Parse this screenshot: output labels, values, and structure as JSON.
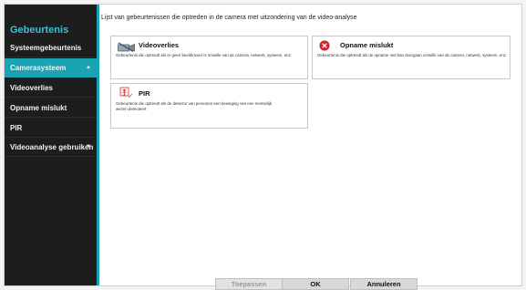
{
  "sidebar": {
    "title": "Gebeurtenis",
    "items": [
      {
        "label": "Systeemgebeurtenis",
        "caret": ""
      },
      {
        "label": "Camerasysteem",
        "caret": "▲"
      },
      {
        "label": "Videoverlies",
        "caret": ""
      },
      {
        "label": "Opname mislukt",
        "caret": ""
      },
      {
        "label": "PIR",
        "caret": ""
      },
      {
        "label": "Videoanalyse gebruiken",
        "caret": "▼"
      }
    ]
  },
  "main": {
    "title": "Lijst van gebeurtenissen die optreden in de camera met uitzondering van de video-analyse",
    "cards": [
      {
        "name": "Videoverlies",
        "icon": "video-loss-icon",
        "description": "Gebeurtenis die optreedt als er geen beeldinvoer is omwille van de camera, netwerk, systeem, enz."
      },
      {
        "name": "Opname mislukt",
        "icon": "record-fail-icon",
        "description": "Gebeurtenis die optreedt als de opname niet kan doorgaan omwille van de camera, netwerk, systeem, enz."
      },
      {
        "name": "PIR",
        "icon": "pir-icon",
        "description": "Gebeurtenis die optreedt als de detector van personen een beweging van een menselijk wezen detecteert"
      }
    ]
  },
  "footer": {
    "apply_label": "Toepassen",
    "ok_label": "OK",
    "cancel_label": "Annuleren"
  },
  "colors": {
    "accent": "#1aa3b3",
    "sidebar_bg": "#1d1d1d",
    "title_color": "#3ec0d3",
    "record_fail_red": "#d9292f",
    "pir_red": "#e03030"
  }
}
